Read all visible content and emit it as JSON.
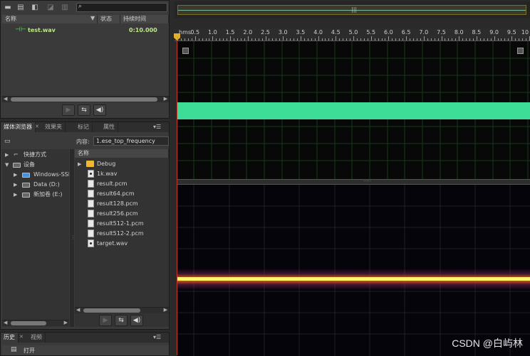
{
  "files_panel": {
    "columns": [
      "名称",
      "状态",
      "持续时间"
    ],
    "file_name": "test.wav",
    "file_duration": "0:10.000"
  },
  "media_browser": {
    "tabs": [
      "媒体浏览器",
      "效果夹",
      "标记",
      "属性"
    ],
    "content_label": "内容:",
    "content_value": "1.ese_top_frequency",
    "name_header": "名称",
    "tree": [
      "快捷方式",
      "设备",
      "Windows-SSD",
      "Data (D:)",
      "新加卷 (E:)"
    ],
    "files": [
      "Debug",
      "1k.wav",
      "result.pcm",
      "result64.pcm",
      "result128.pcm",
      "result256.pcm",
      "result512-1.pcm",
      "result512-2.pcm",
      "target.wav"
    ]
  },
  "history_panel": {
    "tabs": [
      "历史",
      "视频"
    ],
    "items": [
      "打开"
    ]
  },
  "ruler": {
    "start_label": "hms",
    "labels": [
      "0.5",
      "1.0",
      "1.5",
      "2.0",
      "2.5",
      "3.0",
      "3.5",
      "4.0",
      "4.5",
      "5.0",
      "5.5",
      "6.0",
      "6.5",
      "7.0",
      "7.5",
      "8.0",
      "8.5",
      "9.0",
      "9.5",
      "10"
    ]
  },
  "waveform": {
    "colors": {
      "wave": "#3ddc97",
      "spectral_core": "#fff36a",
      "spectral_glow": "#e8501a"
    }
  },
  "watermark": "CSDN @白屿林"
}
